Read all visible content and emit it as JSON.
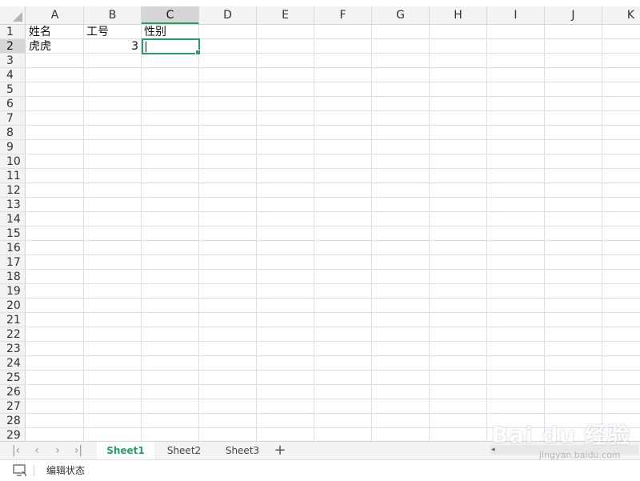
{
  "columns": [
    "A",
    "B",
    "C",
    "D",
    "E",
    "F",
    "G",
    "H",
    "I",
    "J",
    "K"
  ],
  "selected_column": "C",
  "rows": [
    1,
    2,
    3,
    4,
    5,
    6,
    7,
    8,
    9,
    10,
    11,
    12,
    13,
    14,
    15,
    16,
    17,
    18,
    19,
    20,
    21,
    22,
    23,
    24,
    25,
    26,
    27,
    28,
    29
  ],
  "active_row": 2,
  "cells": {
    "A1": "姓名",
    "B1": "工号",
    "C1": "性别",
    "A2": "虎虎",
    "B2": "3"
  },
  "sheets": [
    "Sheet1",
    "Sheet2",
    "Sheet3"
  ],
  "active_sheet": "Sheet1",
  "status": {
    "mode_text": "编辑状态"
  },
  "colors": {
    "accent": "#21a366",
    "header_bg": "#f3f3f3",
    "selected_header_bg": "#d6d6d6"
  },
  "icons": {
    "corner": "select-all-triangle-icon",
    "nav": [
      "first-sheet-icon",
      "prev-sheet-icon",
      "next-sheet-icon",
      "last-sheet-icon"
    ],
    "add_sheet": "plus-icon",
    "status": "screen-icon"
  },
  "watermark": {
    "logo": "Bai du 经验",
    "url": "jingyan.baidu.com"
  }
}
